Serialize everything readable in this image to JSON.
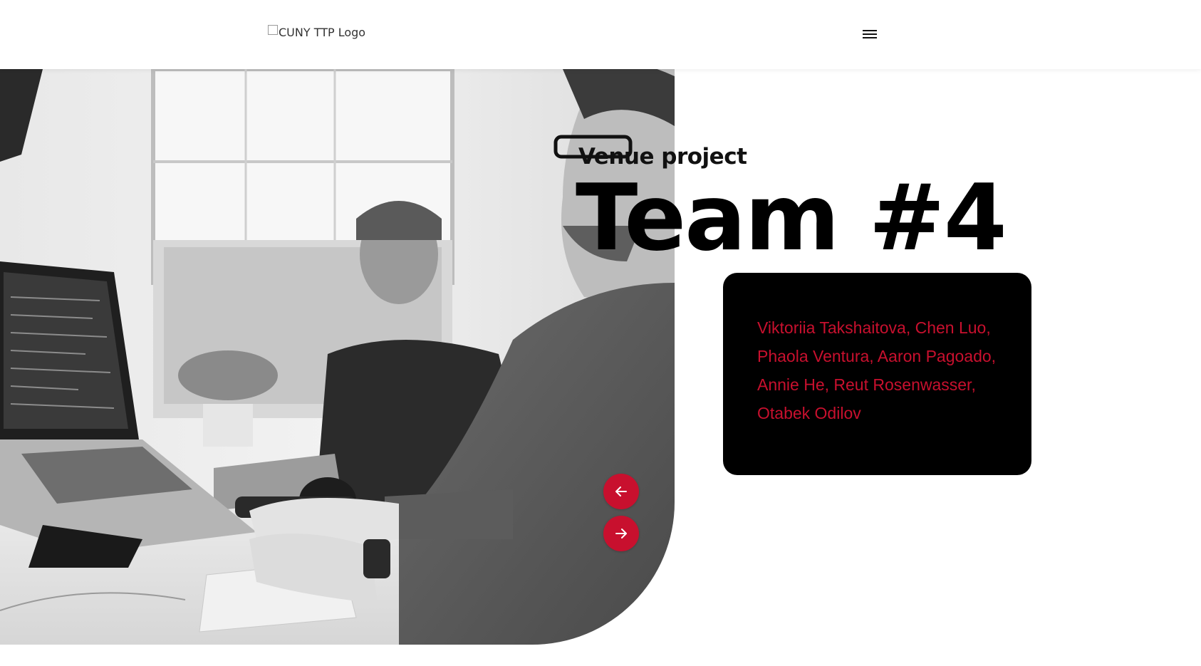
{
  "header": {
    "logo_alt": "CUNY TTP Logo"
  },
  "hero": {
    "subtitle": "Venue project",
    "title": "Team #4"
  },
  "card": {
    "members_text": "Viktoriia Takshaitova, Chen Luo, Phaola Ventura, Aaron Pagoado, Annie He, Reut Rosenwasser, Otabek Odilov"
  },
  "slider": {
    "prev_icon": "arrow-left-icon",
    "next_icon": "arrow-right-icon"
  },
  "colors": {
    "accent": "#c8102e",
    "card_bg": "#000000",
    "title": "#000000"
  }
}
